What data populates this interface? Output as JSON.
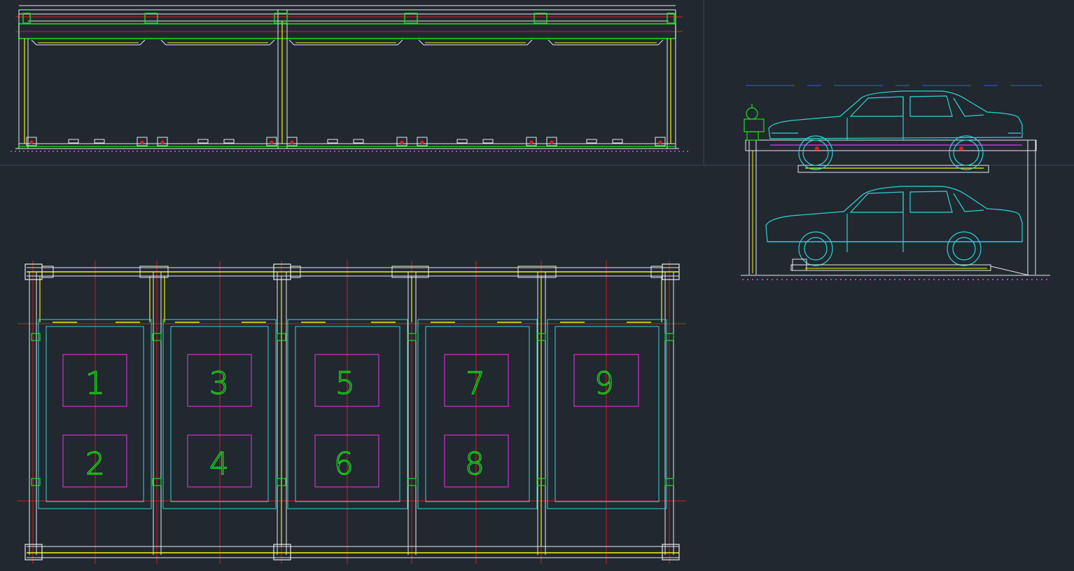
{
  "colors": {
    "background": "#212830",
    "white": "#e8eaec",
    "yellow": "#f2f20a",
    "green": "#19e019",
    "red": "#e31a1a",
    "cyan": "#2fd3d6",
    "magenta": "#cc33cc",
    "blue": "#2f4fe0"
  },
  "plan": {
    "slots": [
      {
        "label": "1"
      },
      {
        "label": "2"
      },
      {
        "label": "3"
      },
      {
        "label": "4"
      },
      {
        "label": "5"
      },
      {
        "label": "6"
      },
      {
        "label": "7"
      },
      {
        "label": "8"
      },
      {
        "label": "9"
      }
    ]
  },
  "icons": [
    "car-side-icon",
    "drive-motor-icon",
    "wheel-icon"
  ]
}
